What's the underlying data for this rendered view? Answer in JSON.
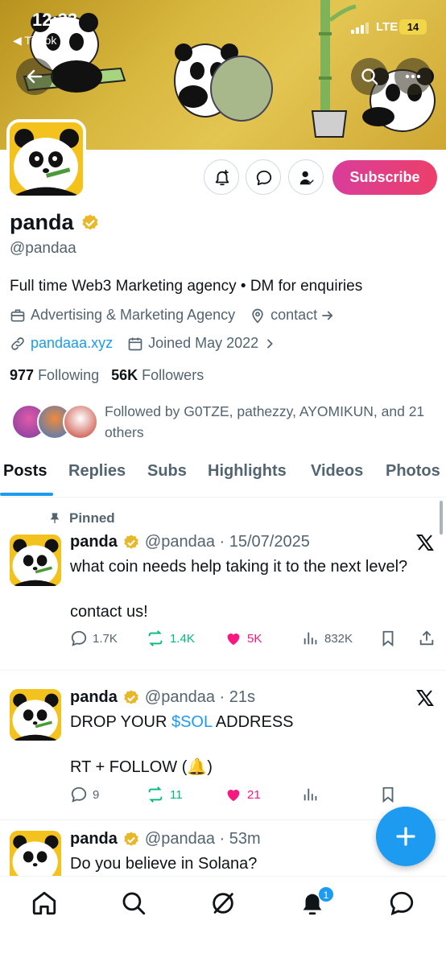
{
  "status_bar": {
    "time": "12:33",
    "back_app": "◀ TikTok",
    "network": "LTE",
    "battery": "14"
  },
  "profile": {
    "name": "panda",
    "handle": "@pandaa",
    "bio": "Full time Web3 Marketing agency • DM for enquiries",
    "category": "Advertising & Marketing Agency",
    "contact_label": "contact",
    "website": "pandaaa.xyz",
    "joined": "Joined May 2022",
    "following_count": "977",
    "following_label": "Following",
    "followers_count": "56K",
    "followers_label": "Followers",
    "followed_by": "Followed by G0TZE, pathezzy, AYOMIKUN, and 21 others"
  },
  "actions": {
    "subscribe_label": "Subscribe"
  },
  "tabs": [
    {
      "label": "Posts"
    },
    {
      "label": "Replies"
    },
    {
      "label": "Subs"
    },
    {
      "label": "Highlights"
    },
    {
      "label": "Videos"
    },
    {
      "label": "Photos"
    }
  ],
  "posts": [
    {
      "pinned_label": "Pinned",
      "name": "panda",
      "handle_time": "@pandaa · 15/07/2025",
      "line1": "what coin needs help taking it to the next level?",
      "line2": "contact us!",
      "replies": "1.7K",
      "reposts": "1.4K",
      "likes": "5K",
      "views": "832K"
    },
    {
      "name": "panda",
      "handle_time": "@pandaa · 21s",
      "line1_pre": "DROP YOUR ",
      "line1_tag": "$SOL",
      "line1_post": " ADDRESS",
      "line2": "RT + FOLLOW (🔔)",
      "replies": "9",
      "reposts": "11",
      "likes": "21"
    },
    {
      "name": "panda",
      "handle_time": "@pandaa · 53m",
      "line1": "Do you believe in Solana?"
    }
  ],
  "bottom_nav": {
    "notifications_badge": "1"
  },
  "colors": {
    "accent": "#1d9bf0",
    "like": "#f91880",
    "repost": "#00ba7c",
    "subscribe": "#e0407f",
    "verified": "#e8b829"
  }
}
